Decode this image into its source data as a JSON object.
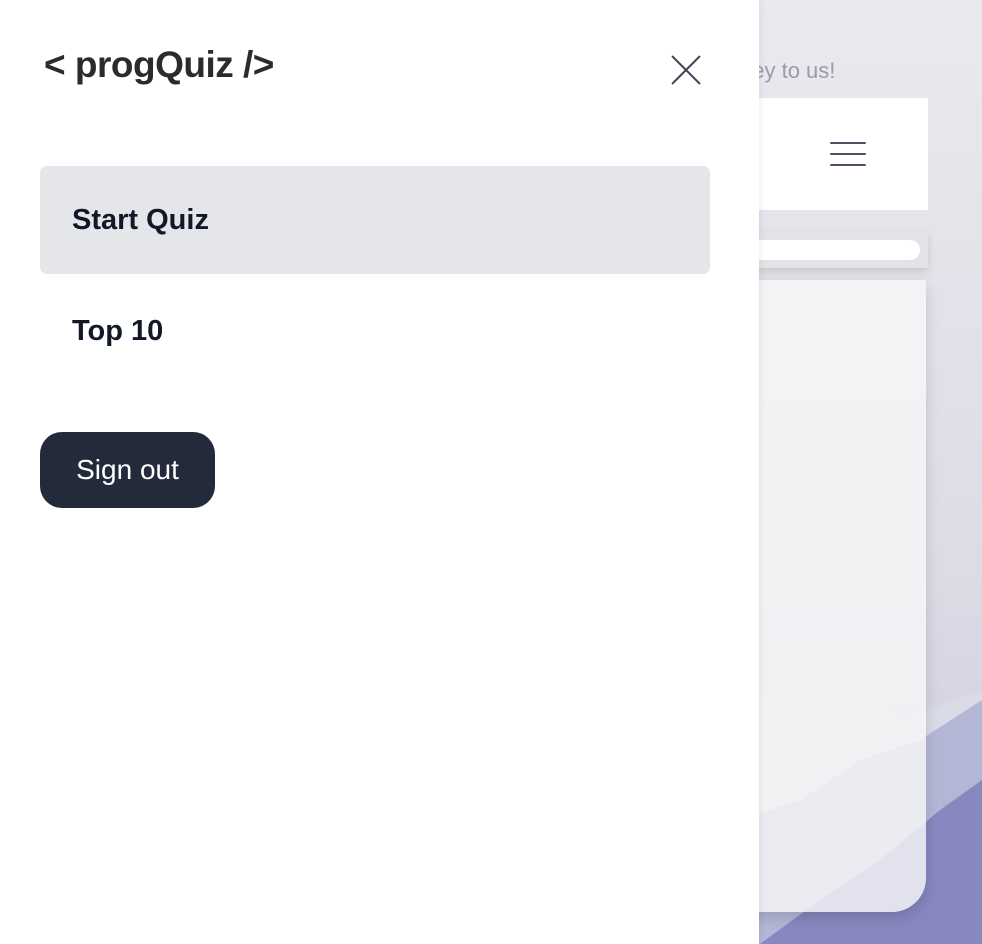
{
  "background": {
    "tagline_fragment": "ney to us!",
    "menu_icon": "hamburger-menu-icon"
  },
  "drawer": {
    "logo": "< progQuiz />",
    "close_icon": "close-icon",
    "nav": [
      {
        "label": "Start Quiz",
        "active": true
      },
      {
        "label": "Top 10",
        "active": false
      }
    ],
    "signout_label": "Sign out"
  },
  "colors": {
    "active_nav_bg": "#e5e6ea",
    "signout_bg": "#232b3a",
    "text_primary": "#111827",
    "mountain_accent": "#8688bf"
  }
}
